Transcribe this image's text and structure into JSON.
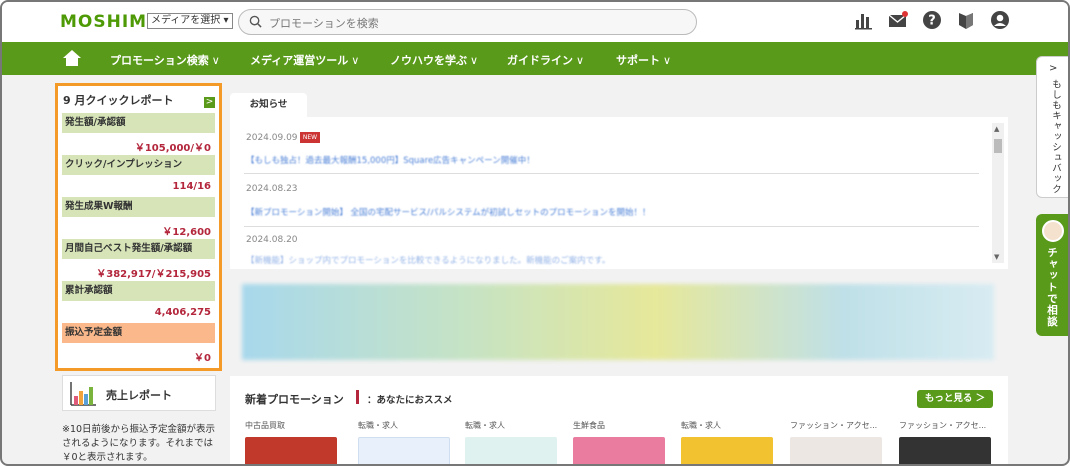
{
  "header": {
    "logo": "MOSHIMO",
    "media_select": "メディアを選択 ▾",
    "search_placeholder": "プロモーションを検索"
  },
  "nav": {
    "items": [
      {
        "label": "プロモーション検索"
      },
      {
        "label": "メディア運営ツール"
      },
      {
        "label": "ノウハウを学ぶ"
      },
      {
        "label": "ガイドライン"
      },
      {
        "label": "サポート"
      }
    ],
    "caret": "∨"
  },
  "report": {
    "title": "9 月クイックレポート",
    "arrow": ">",
    "rows": [
      {
        "label": "発生額/承認額",
        "value": "￥105,000/￥0"
      },
      {
        "label": "クリック/インプレッション",
        "value": "114/16"
      },
      {
        "label": "発生成果W報酬",
        "value": "￥12,600"
      },
      {
        "label": "月間自己ベスト発生額/承認額",
        "value": "￥382,917/￥215,905"
      },
      {
        "label": "累計承認額",
        "value": "4,406,275"
      },
      {
        "label": "振込予定金額",
        "value": "￥0"
      }
    ],
    "sales_report": "売上レポート",
    "note": "※10日前後から振込予定金額が表示されるようになります。それまでは￥0と表示されます。"
  },
  "news": {
    "tab": "お知らせ",
    "items": [
      {
        "date": "2024.09.09",
        "badge": "NEW",
        "text": "【もしも独占！過去最大報酬15,000円】Square広告キャンペーン開催中！"
      },
      {
        "date": "2024.08.23",
        "text": "【新プロモーション開始】 全国の宅配サービス/パルシステムが初試しセットのプロモーションを開始！！"
      },
      {
        "date": "2024.08.20",
        "text": "【新機能】ショップ内でプロモーションを比較できるようになりました。新機能のご案内です。"
      }
    ]
  },
  "promotions": {
    "title": "新着プロモーション",
    "subtitle": "：あなたにおススメ",
    "more": "もっと見る ＞",
    "cards": [
      {
        "category": "中古品買取",
        "color": "#c0392b"
      },
      {
        "category": "転職・求人",
        "color": "#e8f1fb"
      },
      {
        "category": "転職・求人",
        "color": "#dff2ef"
      },
      {
        "category": "生鮮食品",
        "color": "#ea7ca0"
      },
      {
        "category": "転職・求人",
        "color": "#f2c230"
      },
      {
        "category": "ファッション・アクセ...",
        "color": "#ece7e3"
      },
      {
        "category": "ファッション・アクセ...",
        "color": "#333333"
      }
    ]
  },
  "side": {
    "cashback_arrow": ">",
    "cashback": "もしもキャッシュバック",
    "chat": "チャットで相談"
  }
}
